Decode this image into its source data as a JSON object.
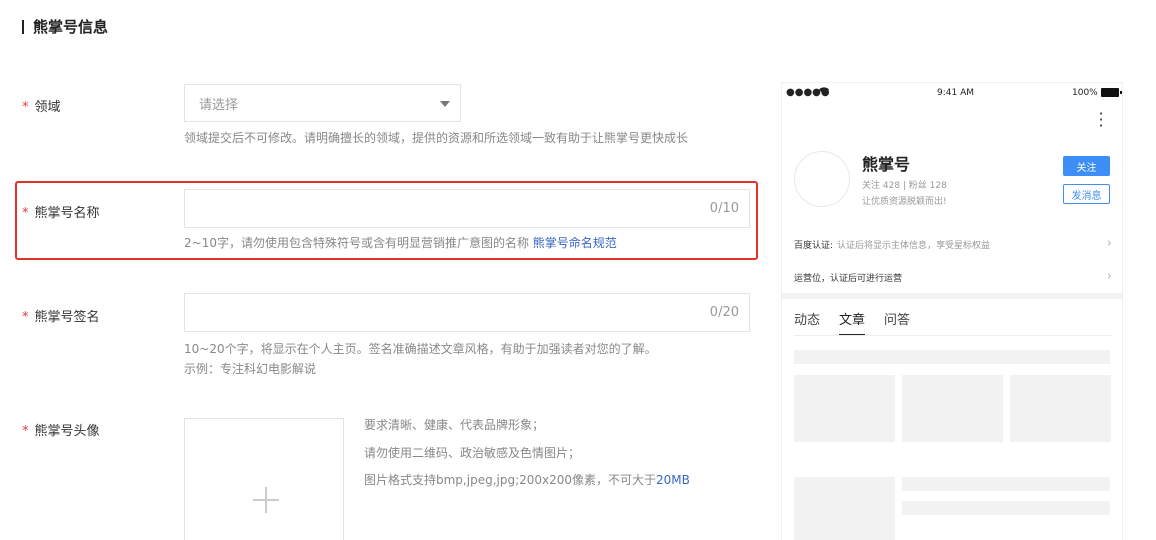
{
  "section": {
    "title": "熊掌号信息"
  },
  "fields": {
    "domain": {
      "label": "领域",
      "placeholder": "请选择",
      "hint": "领域提交后不可修改。请明确擅长的领域，提供的资源和所选领域一致有助于让熊掌号更快成长"
    },
    "name": {
      "label": "熊掌号名称",
      "counter": "0/10",
      "hint": "2~10字，请勿使用包含特殊符号或含有明显营销推广意图的名称",
      "hint_link": "熊掌号命名规范"
    },
    "signature": {
      "label": "熊掌号签名",
      "counter": "0/20",
      "hint_line1": "10~20个字，将显示在个人主页。签名准确描述文章风格，有助于加强读者对您的了解。",
      "hint_line2": "示例：专注科幻电影解说"
    },
    "avatar": {
      "label": "熊掌号头像",
      "req1": "要求清晰、健康、代表品牌形象；",
      "req2": "请勿使用二维码、政治敏感及色情图片；",
      "req3_prefix": "图片格式支持bmp,jpeg,jpg;200x200像素，不可大于",
      "req3_size": "20MB"
    }
  },
  "preview": {
    "status": {
      "signal": "●●●●●",
      "time": "9:41 AM",
      "battery": "100%"
    },
    "account_name": "熊掌号",
    "stats": "关注  428  |  粉丝  128",
    "slogan": "让优质资源脱颖而出!",
    "follow_label": "关注",
    "message_label": "发消息",
    "cert_label": "百度认证:",
    "cert_sub": "认证后将显示主体信息，享受星标权益",
    "ops_label": "运营位，认证后可进行运营",
    "tabs": [
      "动态",
      "文章",
      "问答"
    ],
    "active_tab": 1
  }
}
